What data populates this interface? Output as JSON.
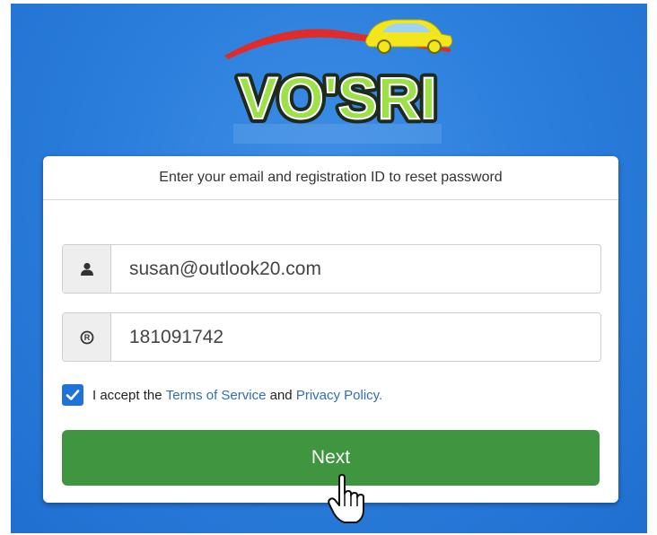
{
  "logo": {
    "text": "VO'SRI"
  },
  "form": {
    "header": "Enter your email and registration ID to reset password",
    "email_value": "susan@outlook20.com",
    "regid_value": "181091742",
    "terms": {
      "prefix": "I accept the",
      "terms_link": "Terms of Service",
      "middle": "and",
      "privacy_link": "Privacy Policy.",
      "checked": true
    },
    "next_label": "Next"
  },
  "colors": {
    "background": "#2c7fdc",
    "button": "#3f9540",
    "checkbox": "#1e73d8",
    "link": "#2f6fb5"
  },
  "icons": {
    "email_field": "user-icon",
    "regid_field": "registered-icon",
    "cursor": "hand-pointer-icon"
  }
}
